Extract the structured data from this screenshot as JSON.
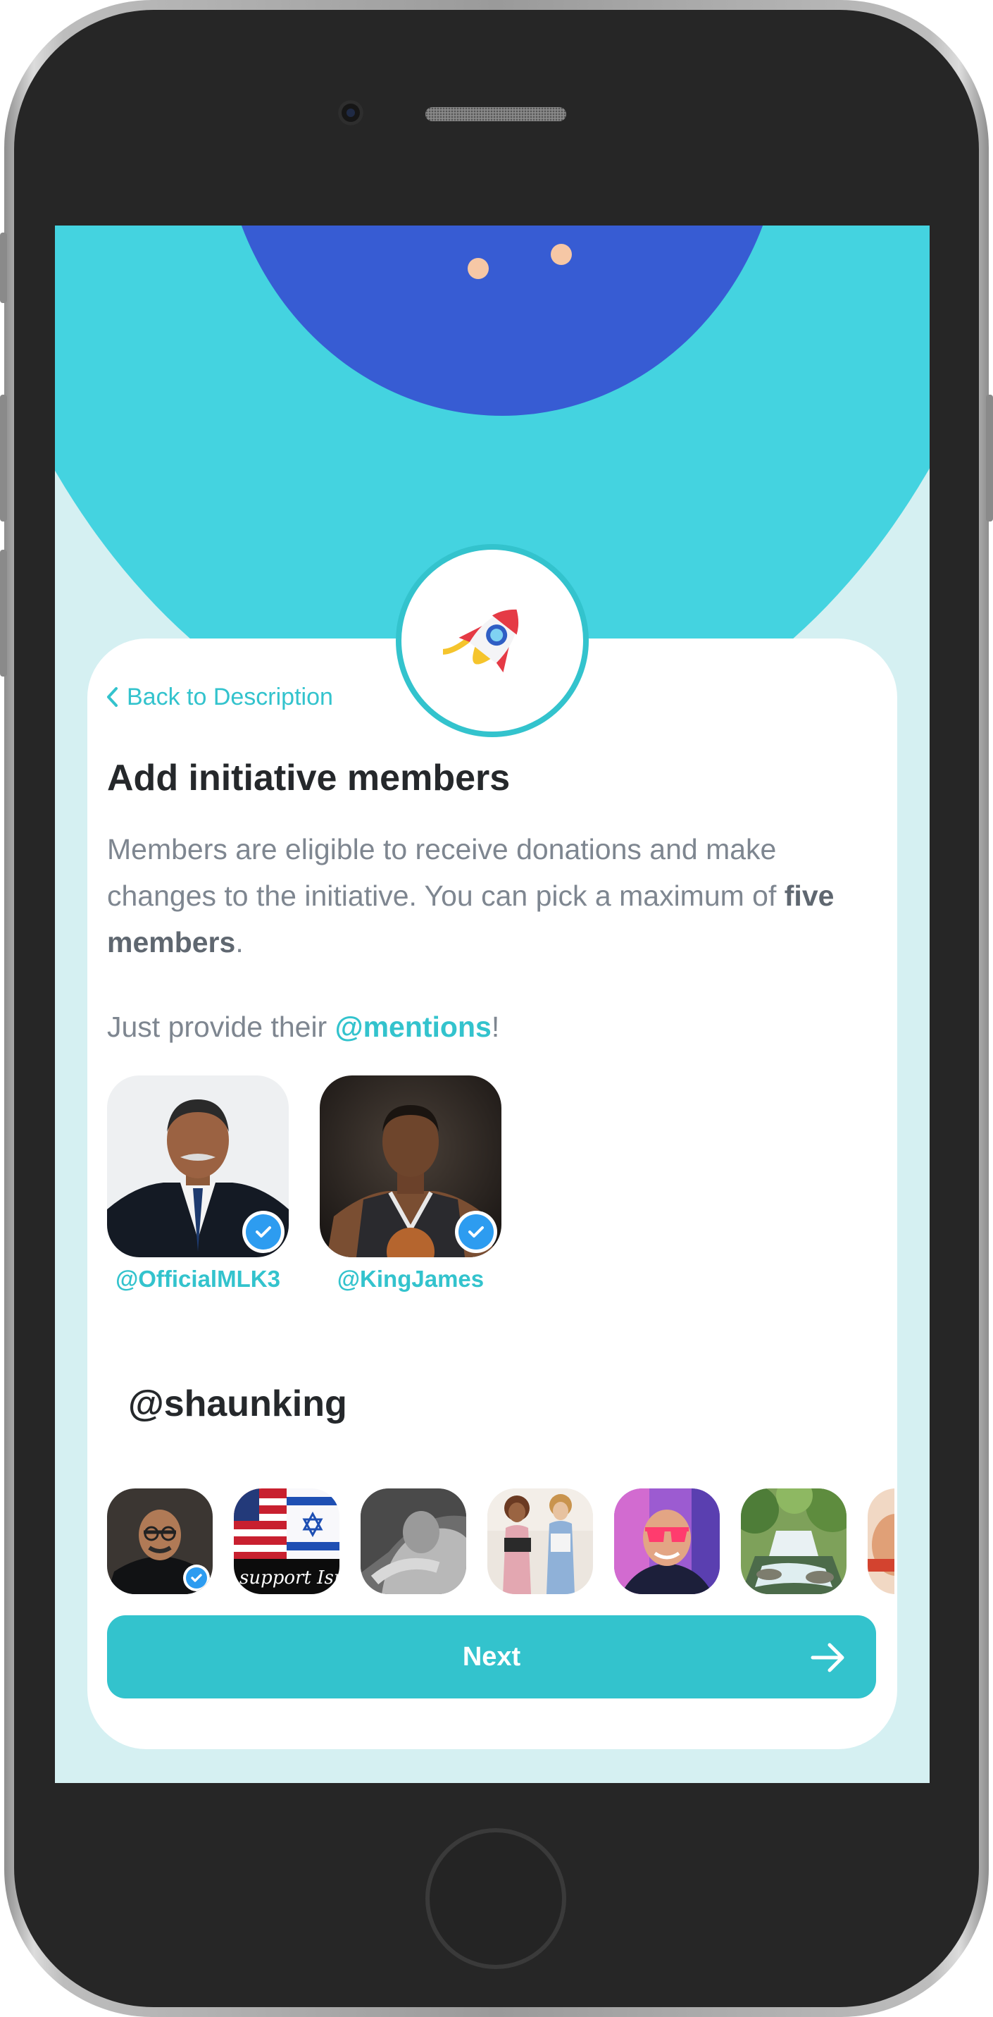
{
  "back_link": {
    "label": "Back to Description"
  },
  "heading": "Add initiative members",
  "description": {
    "text": "Members are eligible to receive donations and make changes to the initiative. You can pick a maximum of",
    "emphasis": "five members",
    "end": "."
  },
  "mention_hint": {
    "prefix": "Just provide their ",
    "highlight": "@mentions",
    "suffix": "!"
  },
  "selected_members": [
    {
      "handle": "@OfficialMLK3",
      "verified": true
    },
    {
      "handle": "@KingJames",
      "verified": true
    }
  ],
  "search": {
    "value": "@shaunking"
  },
  "search_results": [
    {
      "photo": "man-glasses-portrait",
      "verified": true
    },
    {
      "photo": "us-israel-flags-banner",
      "banner_text": "support Isra",
      "verified": false
    },
    {
      "photo": "grayscale-portrait",
      "verified": false
    },
    {
      "photo": "two-kids-photo",
      "verified": false
    },
    {
      "photo": "man-sunglasses-neon",
      "verified": false
    },
    {
      "photo": "waterfall-landscape",
      "verified": false
    },
    {
      "photo": "partial-portrait",
      "verified": false
    }
  ],
  "next_button": {
    "label": "Next"
  },
  "colors": {
    "accent": "#33c3cd",
    "hero_cyan": "#44d3e0",
    "hero_blue": "#375cd3",
    "background": "#d5f0f2",
    "verified": "#2d9cf0"
  }
}
